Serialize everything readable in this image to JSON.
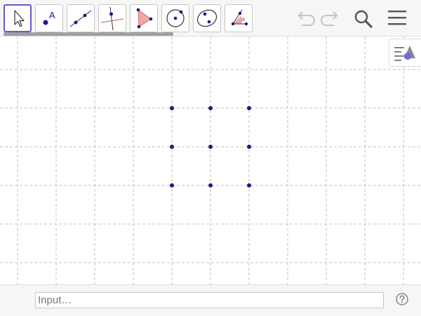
{
  "toolbar": {
    "tools": [
      {
        "name": "move-tool",
        "selected": true
      },
      {
        "name": "point-tool",
        "label": "A"
      },
      {
        "name": "line-tool"
      },
      {
        "name": "perpendicular-line-tool"
      },
      {
        "name": "polygon-tool"
      },
      {
        "name": "circle-with-center-tool"
      },
      {
        "name": "conic-through-points-tool"
      },
      {
        "name": "angle-tool",
        "label": "α"
      }
    ],
    "undo_icon": "undo-icon",
    "redo_icon": "redo-icon",
    "search_icon": "search-icon",
    "menu_icon": "hamburger-menu-icon"
  },
  "graphics": {
    "grid": true,
    "grid_style": "dashed",
    "grid_color": "#c0c0c0",
    "point_color": "#1a1a8e",
    "points": [
      {
        "col": 0,
        "row": 0
      },
      {
        "col": 1,
        "row": 0
      },
      {
        "col": 2,
        "row": 0
      },
      {
        "col": 0,
        "row": 1
      },
      {
        "col": 1,
        "row": 1
      },
      {
        "col": 2,
        "row": 1
      },
      {
        "col": 0,
        "row": 2
      },
      {
        "col": 1,
        "row": 2
      },
      {
        "col": 2,
        "row": 2
      }
    ],
    "style_bar_icon": "style-bar-toggle-icon"
  },
  "input_bar": {
    "placeholder": "Input…",
    "help_icon": "help-icon"
  },
  "colors": {
    "accent": "#6557d2",
    "toolbar_bg": "#f6f6f6"
  }
}
